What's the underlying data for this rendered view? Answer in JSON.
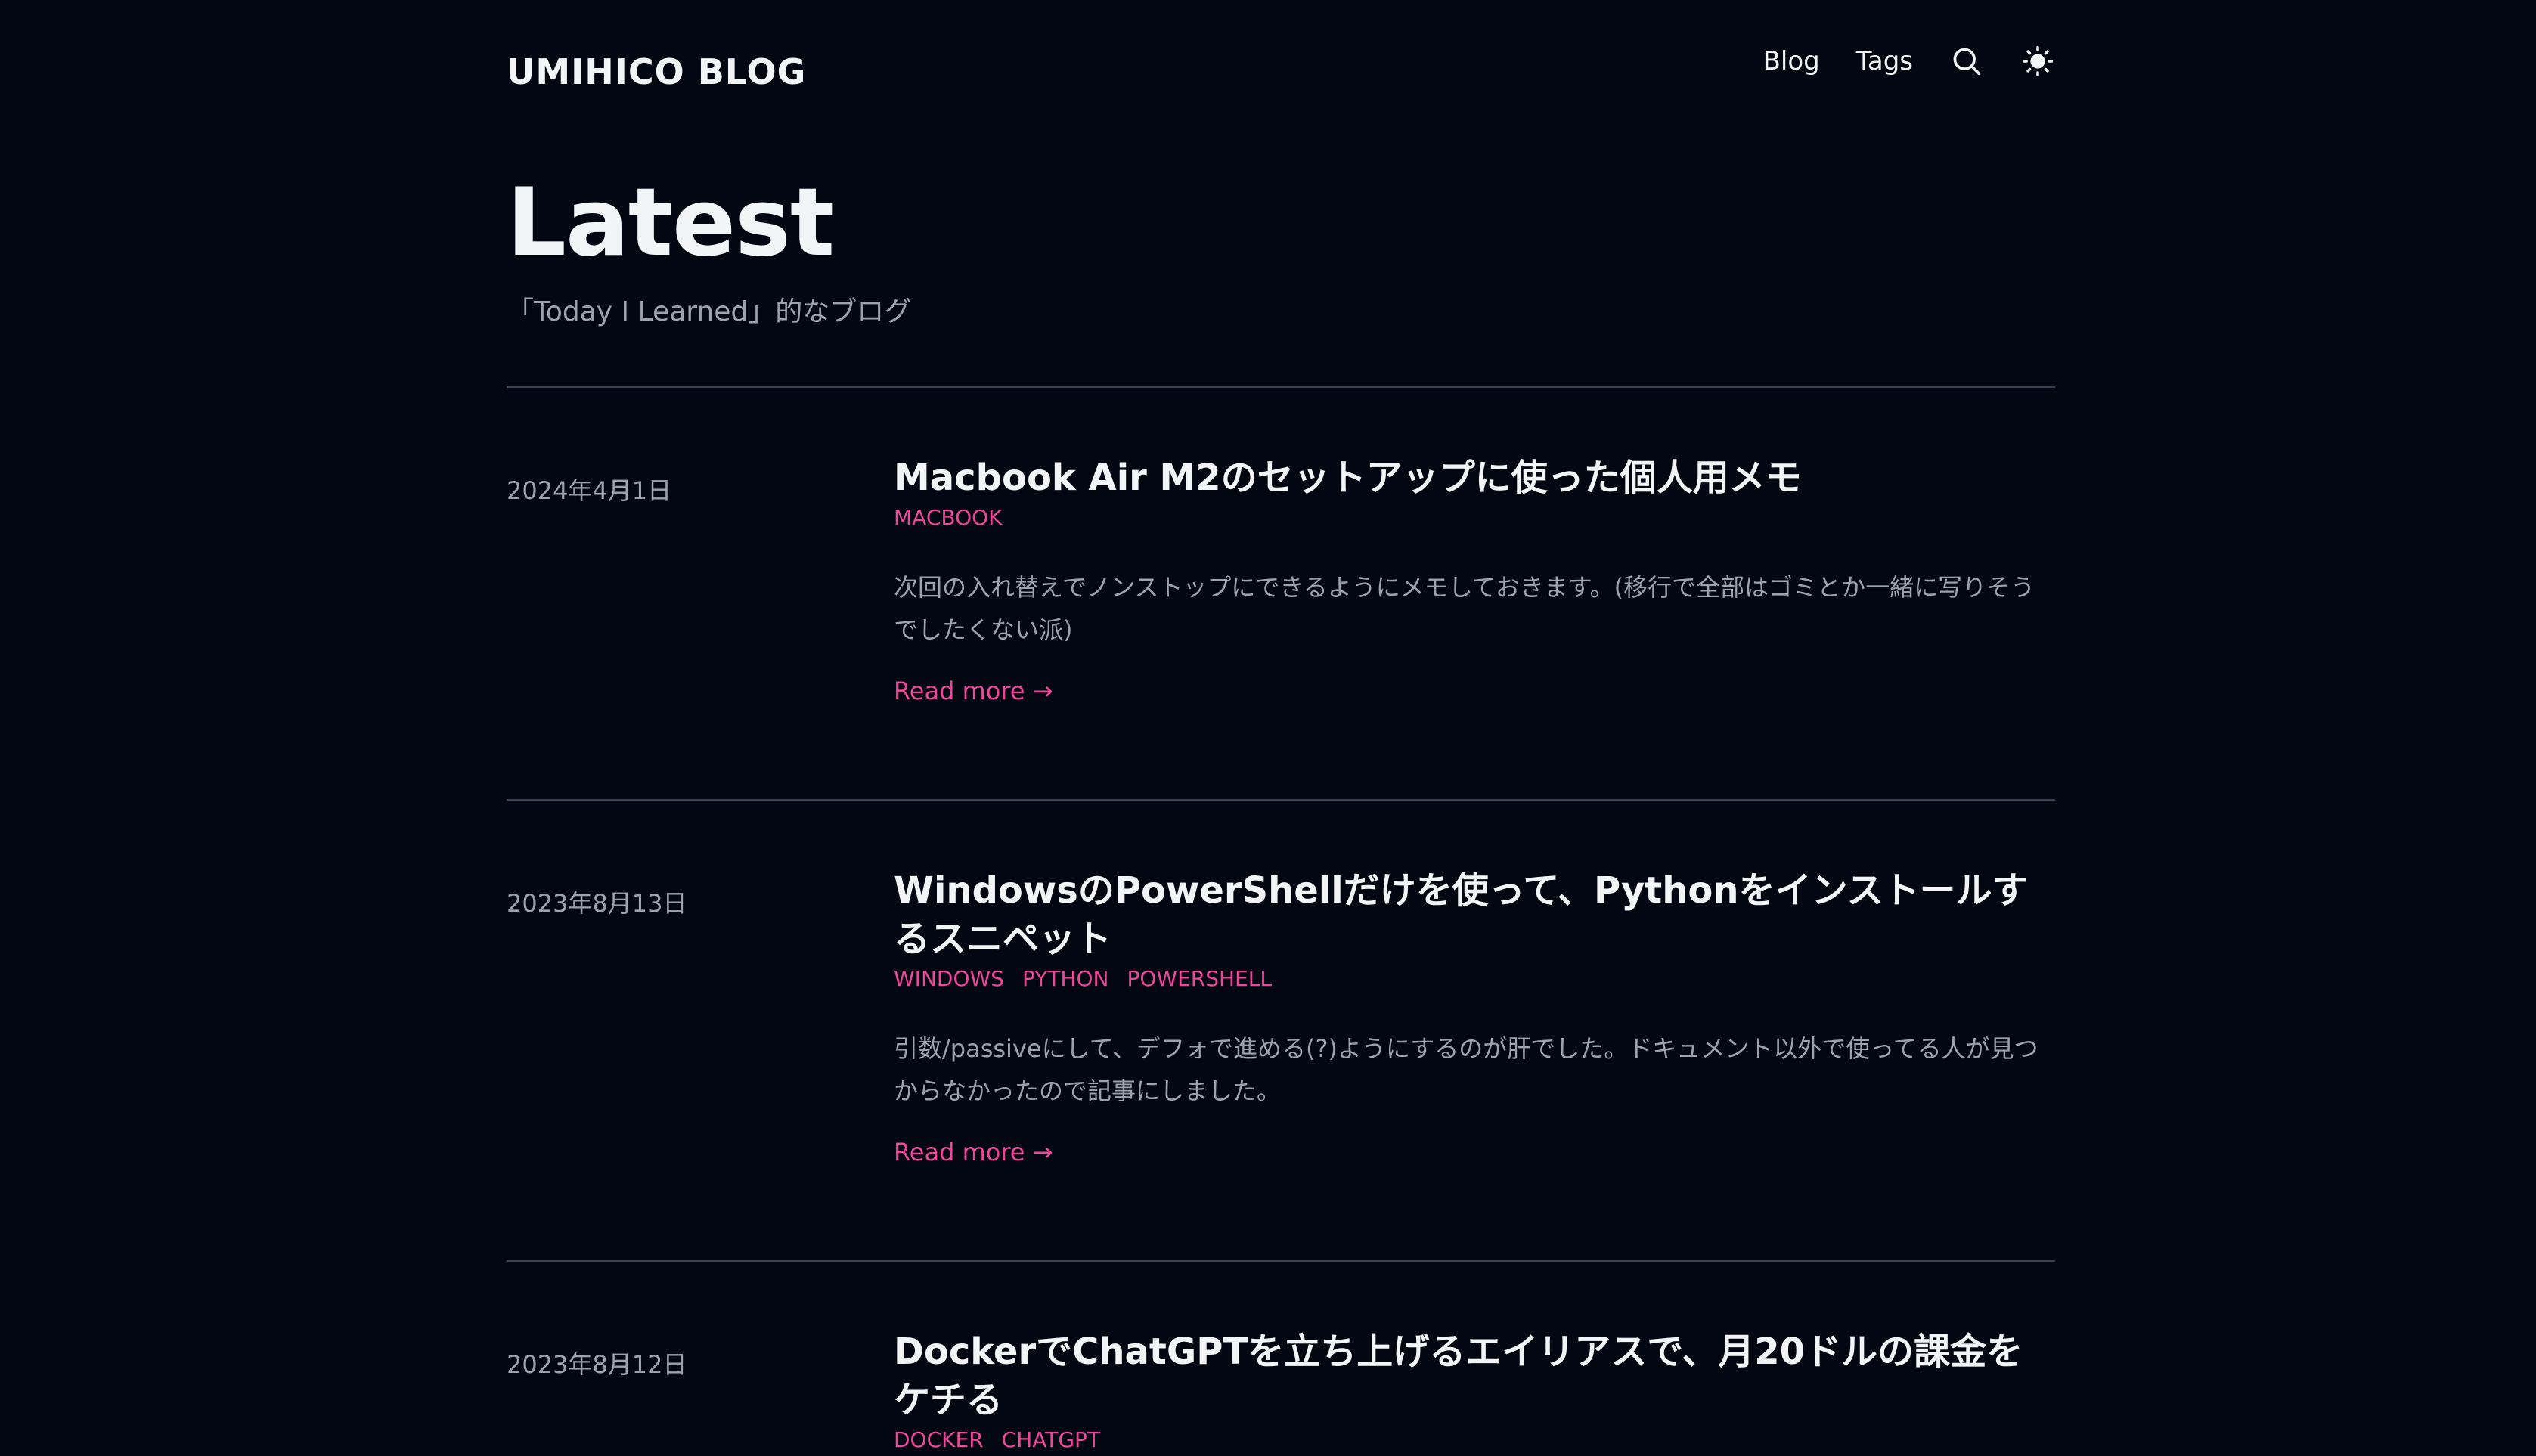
{
  "header": {
    "logo": "UMIHICO BLOG",
    "nav": [
      {
        "label": "Blog"
      },
      {
        "label": "Tags"
      }
    ],
    "icons": [
      "search-icon",
      "sun-icon"
    ]
  },
  "hero": {
    "title": "Latest",
    "subtitle": "「Today I Learned」的なブログ"
  },
  "posts": [
    {
      "date": "2024年4月1日",
      "title": "Macbook Air M2のセットアップに使った個人用メモ",
      "tags": [
        "MACBOOK"
      ],
      "excerpt": "次回の入れ替えでノンストップにできるようにメモしておきます。(移行で全部はゴミとか一緒に写りそうでしたくない派)",
      "read_more": "Read more →"
    },
    {
      "date": "2023年8月13日",
      "title": "WindowsのPowerShellだけを使って、Pythonをインストールするスニペット",
      "tags": [
        "WINDOWS",
        "PYTHON",
        "POWERSHELL"
      ],
      "excerpt": "引数/passiveにして、デフォで進める(?)ようにするのが肝でした。ドキュメント以外で使ってる人が見つからなかったので記事にしました。",
      "read_more": "Read more →"
    },
    {
      "date": "2023年8月12日",
      "title": "DockerでChatGPTを立ち上げるエイリアスで、月20ドルの課金をケチる",
      "tags": [
        "DOCKER",
        "CHATGPT"
      ]
    }
  ],
  "colors": {
    "background": "#030712",
    "accent": "#ec4899",
    "text": "#f3f4f6",
    "muted": "#9ca3af",
    "divider": "#374151"
  }
}
